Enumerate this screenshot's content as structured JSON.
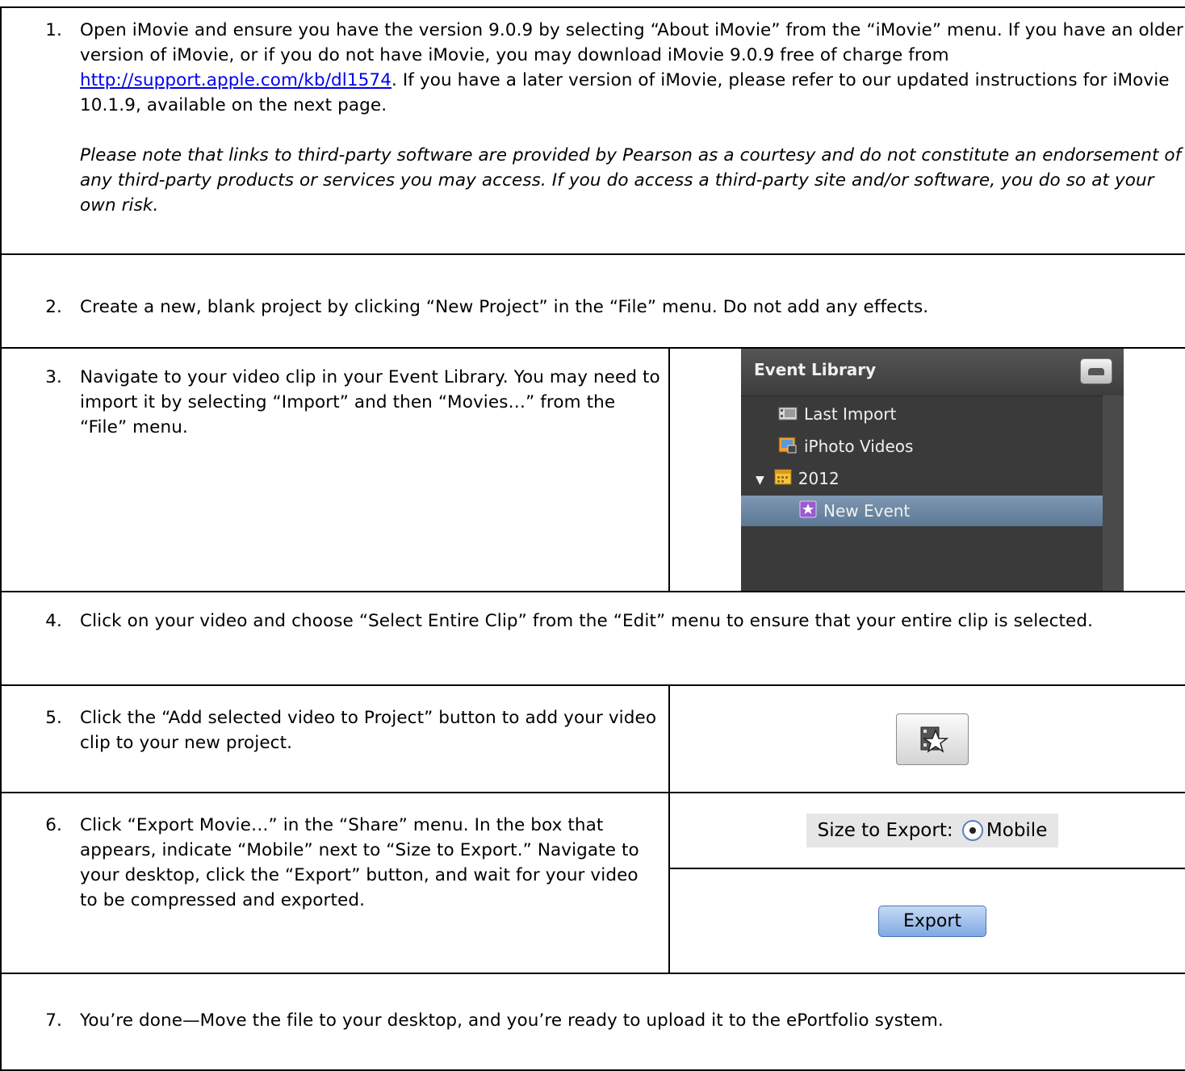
{
  "steps": [
    {
      "num": "1.",
      "text_before": "Open iMovie and ensure you have the version 9.0.9 by selecting “About iMovie” from the “iMovie” menu. If you have an older version of iMovie, or if you do not have iMovie, you may download iMovie 9.0.9 free of charge from ",
      "link": "http://support.apple.com/kb/dl1574",
      "text_after": ". If you have a later version of iMovie, please refer to our updated instructions for iMovie 10.1.9, available on the next page.",
      "note": "Please note that links to third-party software are provided by Pearson as a courtesy and do not constitute an endorsement of any third-party products or services you may access. If you do access a third-party site and/or software, you do so at your own risk."
    },
    {
      "num": "2.",
      "text": "Create a new, blank project by clicking “New Project” in the “File” menu. Do not add any effects."
    },
    {
      "num": "3.",
      "text": "Navigate to your video clip in your Event Library. You may need to import it by selecting “Import” and then “Movies…” from the “File” menu."
    },
    {
      "num": "4.",
      "text": "Click on your video and choose “Select Entire Clip” from the “Edit” menu to ensure that your entire clip is selected."
    },
    {
      "num": "5.",
      "text": "Click the “Add selected video to Project” button to add your video clip to your new project."
    },
    {
      "num": "6.",
      "text": "Click “Export Movie…” in the “Share” menu. In the box that appears, indicate “Mobile” next to “Size to Export.”  Navigate to your desktop, click the “Export” button, and wait for your video to be compressed and exported."
    },
    {
      "num": "7.",
      "text": "You’re done—Move the file to your desktop, and you’re ready to upload it to the ePortfolio system."
    }
  ],
  "event_library": {
    "title": "Event Library",
    "items": [
      {
        "label": "Last Import",
        "icon": "film-icon"
      },
      {
        "label": "iPhoto Videos",
        "icon": "iphoto-icon"
      },
      {
        "label": "2012",
        "icon": "calendar-icon",
        "expanded": true
      },
      {
        "label": "New Event",
        "icon": "star-icon",
        "selected": true
      }
    ]
  },
  "size_export": {
    "label": "Size to Export:",
    "option": "Mobile"
  },
  "export_button": "Export"
}
